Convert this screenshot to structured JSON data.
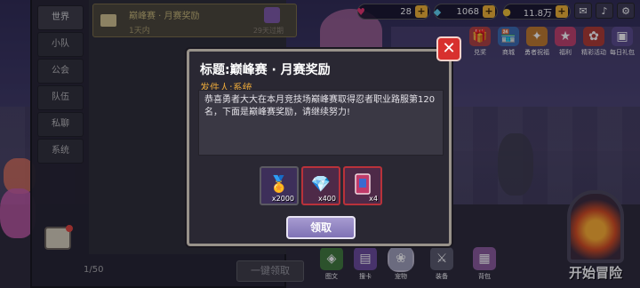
{
  "resources": {
    "stamina": "28",
    "gems": "1068",
    "gold": "11.8万"
  },
  "menu": [
    "兑奖",
    "商城",
    "勇者祝福",
    "福利",
    "精彩活动",
    "每日礼包"
  ],
  "mail": {
    "tabs": [
      "世界",
      "小队",
      "公会",
      "队伍",
      "私聊",
      "系统"
    ],
    "active_tab": "世界",
    "item": {
      "title": "巅峰赛 · 月赛奖励",
      "expiry": "1天内",
      "remaining": "29天过期"
    },
    "count": "1/50",
    "claim_all_label": "一键领取"
  },
  "dialog": {
    "title": "标题:巅峰赛 · 月赛奖励",
    "sender": "发件人:系统",
    "body": "恭喜勇者大大在本月竞技场巅峰赛取得忍者职业路服第120名，下面是巅峰赛奖励，请继续努力!",
    "rewards": [
      {
        "icon": "medal-icon",
        "qty": "x2000",
        "border": "#5b5a62"
      },
      {
        "icon": "diamond-icon",
        "qty": "x400",
        "border": "#b9323a"
      },
      {
        "icon": "card-icon",
        "qty": "x4",
        "border": "#b9323a"
      }
    ],
    "collect_label": "领取",
    "close_label": "✕"
  },
  "bottom_bar": [
    "图文",
    "搜卡",
    "宠物",
    "装备",
    "背包"
  ],
  "start_label": "开始冒险"
}
